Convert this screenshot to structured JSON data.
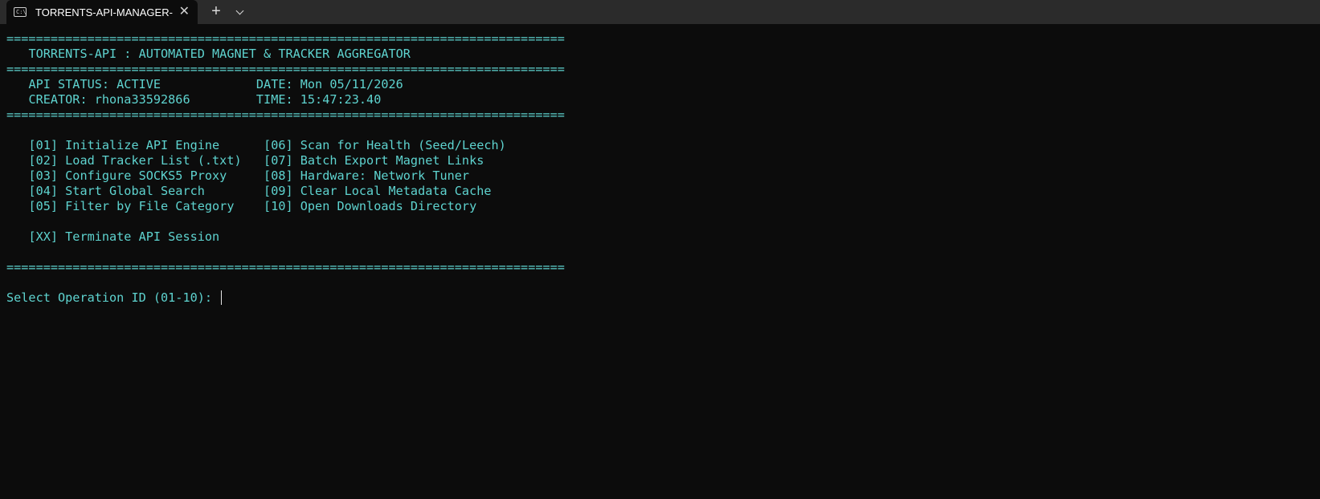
{
  "window": {
    "tab_title": "TORRENTS-API-MANAGER-",
    "tab_icon": "terminal-icon",
    "close_icon": "close-icon",
    "new_tab_glyph": "+",
    "dropdown_icon": "chevron-down-icon"
  },
  "terminal": {
    "text_color": "#5ed3cf",
    "background": "#0c0c0c",
    "separator": "============================================================================",
    "header_title": "TORRENTS-API : AUTOMATED MAGNET & TRACKER AGGREGATOR",
    "status_line": "API STATUS: ACTIVE",
    "date_line": "DATE: Mon 05/11/2026",
    "creator_line": "CREATOR: rhona33592866",
    "time_line": "TIME: 15:47:23.40",
    "menu_left": [
      "[01] Initialize API Engine",
      "[02] Load Tracker List (.txt)",
      "[03] Configure SOCKS5 Proxy",
      "[04] Start Global Search",
      "[05] Filter by File Category"
    ],
    "menu_right": [
      "[06] Scan for Health (Seed/Leech)",
      "[07] Batch Export Magnet Links",
      "[08] Hardware: Network Tuner",
      "[09] Clear Local Metadata Cache",
      "[10] Open Downloads Directory"
    ],
    "terminate": "[XX] Terminate API Session",
    "prompt": "Select Operation ID (01-10): "
  }
}
